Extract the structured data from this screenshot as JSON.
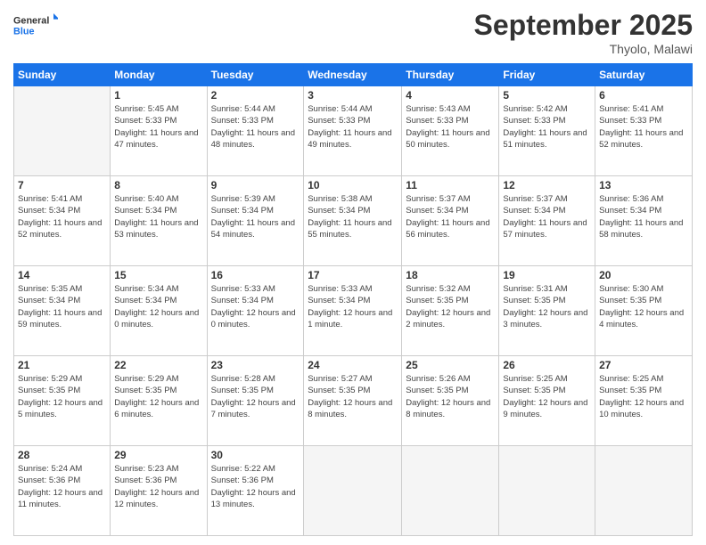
{
  "header": {
    "logo_general": "General",
    "logo_blue": "Blue",
    "month_title": "September 2025",
    "location": "Thyolo, Malawi"
  },
  "columns": [
    "Sunday",
    "Monday",
    "Tuesday",
    "Wednesday",
    "Thursday",
    "Friday",
    "Saturday"
  ],
  "weeks": [
    [
      {
        "day": "",
        "sunrise": "",
        "sunset": "",
        "daylight": "",
        "empty": true
      },
      {
        "day": "1",
        "sunrise": "Sunrise: 5:45 AM",
        "sunset": "Sunset: 5:33 PM",
        "daylight": "Daylight: 11 hours and 47 minutes."
      },
      {
        "day": "2",
        "sunrise": "Sunrise: 5:44 AM",
        "sunset": "Sunset: 5:33 PM",
        "daylight": "Daylight: 11 hours and 48 minutes."
      },
      {
        "day": "3",
        "sunrise": "Sunrise: 5:44 AM",
        "sunset": "Sunset: 5:33 PM",
        "daylight": "Daylight: 11 hours and 49 minutes."
      },
      {
        "day": "4",
        "sunrise": "Sunrise: 5:43 AM",
        "sunset": "Sunset: 5:33 PM",
        "daylight": "Daylight: 11 hours and 50 minutes."
      },
      {
        "day": "5",
        "sunrise": "Sunrise: 5:42 AM",
        "sunset": "Sunset: 5:33 PM",
        "daylight": "Daylight: 11 hours and 51 minutes."
      },
      {
        "day": "6",
        "sunrise": "Sunrise: 5:41 AM",
        "sunset": "Sunset: 5:33 PM",
        "daylight": "Daylight: 11 hours and 52 minutes."
      }
    ],
    [
      {
        "day": "7",
        "sunrise": "Sunrise: 5:41 AM",
        "sunset": "Sunset: 5:34 PM",
        "daylight": "Daylight: 11 hours and 52 minutes."
      },
      {
        "day": "8",
        "sunrise": "Sunrise: 5:40 AM",
        "sunset": "Sunset: 5:34 PM",
        "daylight": "Daylight: 11 hours and 53 minutes."
      },
      {
        "day": "9",
        "sunrise": "Sunrise: 5:39 AM",
        "sunset": "Sunset: 5:34 PM",
        "daylight": "Daylight: 11 hours and 54 minutes."
      },
      {
        "day": "10",
        "sunrise": "Sunrise: 5:38 AM",
        "sunset": "Sunset: 5:34 PM",
        "daylight": "Daylight: 11 hours and 55 minutes."
      },
      {
        "day": "11",
        "sunrise": "Sunrise: 5:37 AM",
        "sunset": "Sunset: 5:34 PM",
        "daylight": "Daylight: 11 hours and 56 minutes."
      },
      {
        "day": "12",
        "sunrise": "Sunrise: 5:37 AM",
        "sunset": "Sunset: 5:34 PM",
        "daylight": "Daylight: 11 hours and 57 minutes."
      },
      {
        "day": "13",
        "sunrise": "Sunrise: 5:36 AM",
        "sunset": "Sunset: 5:34 PM",
        "daylight": "Daylight: 11 hours and 58 minutes."
      }
    ],
    [
      {
        "day": "14",
        "sunrise": "Sunrise: 5:35 AM",
        "sunset": "Sunset: 5:34 PM",
        "daylight": "Daylight: 11 hours and 59 minutes."
      },
      {
        "day": "15",
        "sunrise": "Sunrise: 5:34 AM",
        "sunset": "Sunset: 5:34 PM",
        "daylight": "Daylight: 12 hours and 0 minutes."
      },
      {
        "day": "16",
        "sunrise": "Sunrise: 5:33 AM",
        "sunset": "Sunset: 5:34 PM",
        "daylight": "Daylight: 12 hours and 0 minutes."
      },
      {
        "day": "17",
        "sunrise": "Sunrise: 5:33 AM",
        "sunset": "Sunset: 5:34 PM",
        "daylight": "Daylight: 12 hours and 1 minute."
      },
      {
        "day": "18",
        "sunrise": "Sunrise: 5:32 AM",
        "sunset": "Sunset: 5:35 PM",
        "daylight": "Daylight: 12 hours and 2 minutes."
      },
      {
        "day": "19",
        "sunrise": "Sunrise: 5:31 AM",
        "sunset": "Sunset: 5:35 PM",
        "daylight": "Daylight: 12 hours and 3 minutes."
      },
      {
        "day": "20",
        "sunrise": "Sunrise: 5:30 AM",
        "sunset": "Sunset: 5:35 PM",
        "daylight": "Daylight: 12 hours and 4 minutes."
      }
    ],
    [
      {
        "day": "21",
        "sunrise": "Sunrise: 5:29 AM",
        "sunset": "Sunset: 5:35 PM",
        "daylight": "Daylight: 12 hours and 5 minutes."
      },
      {
        "day": "22",
        "sunrise": "Sunrise: 5:29 AM",
        "sunset": "Sunset: 5:35 PM",
        "daylight": "Daylight: 12 hours and 6 minutes."
      },
      {
        "day": "23",
        "sunrise": "Sunrise: 5:28 AM",
        "sunset": "Sunset: 5:35 PM",
        "daylight": "Daylight: 12 hours and 7 minutes."
      },
      {
        "day": "24",
        "sunrise": "Sunrise: 5:27 AM",
        "sunset": "Sunset: 5:35 PM",
        "daylight": "Daylight: 12 hours and 8 minutes."
      },
      {
        "day": "25",
        "sunrise": "Sunrise: 5:26 AM",
        "sunset": "Sunset: 5:35 PM",
        "daylight": "Daylight: 12 hours and 8 minutes."
      },
      {
        "day": "26",
        "sunrise": "Sunrise: 5:25 AM",
        "sunset": "Sunset: 5:35 PM",
        "daylight": "Daylight: 12 hours and 9 minutes."
      },
      {
        "day": "27",
        "sunrise": "Sunrise: 5:25 AM",
        "sunset": "Sunset: 5:35 PM",
        "daylight": "Daylight: 12 hours and 10 minutes."
      }
    ],
    [
      {
        "day": "28",
        "sunrise": "Sunrise: 5:24 AM",
        "sunset": "Sunset: 5:36 PM",
        "daylight": "Daylight: 12 hours and 11 minutes."
      },
      {
        "day": "29",
        "sunrise": "Sunrise: 5:23 AM",
        "sunset": "Sunset: 5:36 PM",
        "daylight": "Daylight: 12 hours and 12 minutes."
      },
      {
        "day": "30",
        "sunrise": "Sunrise: 5:22 AM",
        "sunset": "Sunset: 5:36 PM",
        "daylight": "Daylight: 12 hours and 13 minutes."
      },
      {
        "day": "",
        "sunrise": "",
        "sunset": "",
        "daylight": "",
        "empty": true
      },
      {
        "day": "",
        "sunrise": "",
        "sunset": "",
        "daylight": "",
        "empty": true
      },
      {
        "day": "",
        "sunrise": "",
        "sunset": "",
        "daylight": "",
        "empty": true
      },
      {
        "day": "",
        "sunrise": "",
        "sunset": "",
        "daylight": "",
        "empty": true
      }
    ]
  ]
}
